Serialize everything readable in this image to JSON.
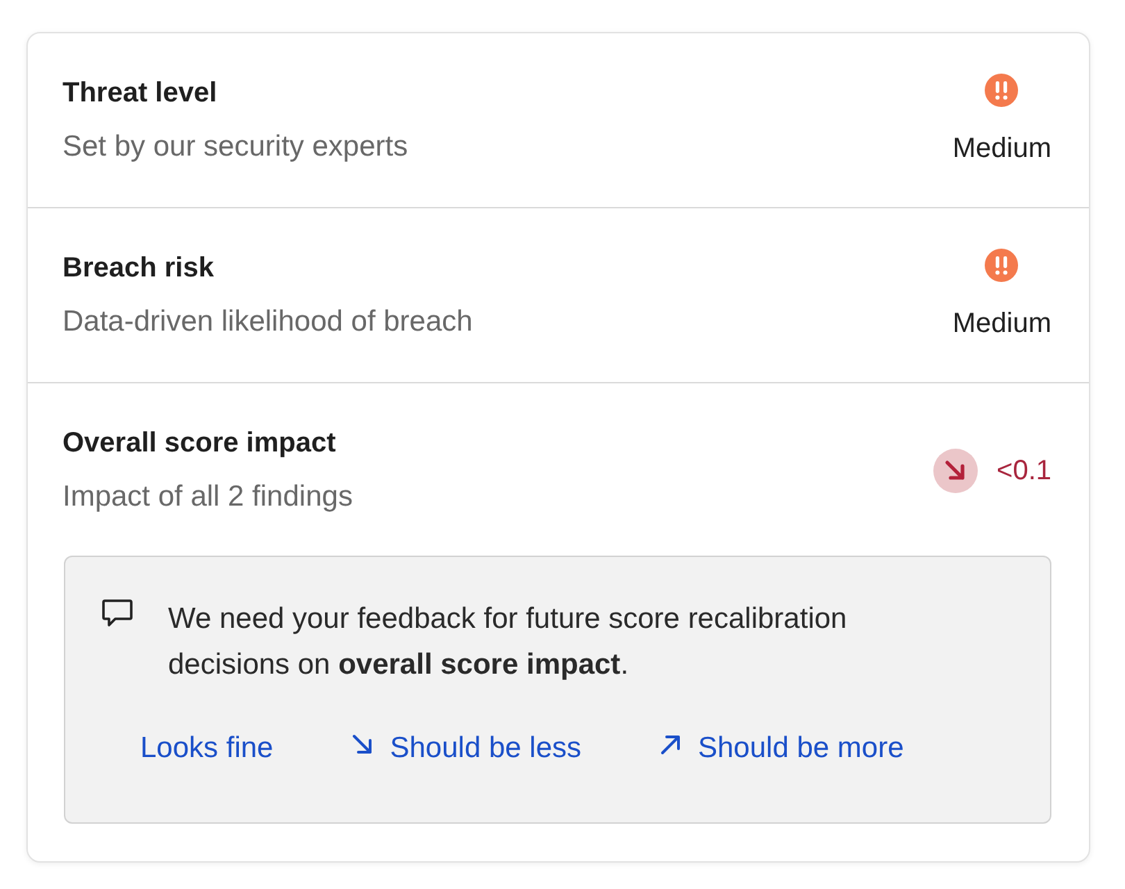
{
  "rows": [
    {
      "kind": "severity",
      "title": "Threat level",
      "subtitle": "Set by our security experts",
      "value": "Medium"
    },
    {
      "kind": "severity",
      "title": "Breach risk",
      "subtitle": "Data-driven likelihood of breach",
      "value": "Medium"
    },
    {
      "kind": "impact",
      "title": "Overall score impact",
      "subtitle": "Impact of all 2 findings",
      "value": "<0.1",
      "decreasing": true
    }
  ],
  "feedback": {
    "message": "We need your feedback for future score recalibration decisions on **overall score impact**.",
    "options": [
      {
        "kind": "plain",
        "label": "Looks fine"
      },
      {
        "kind": "less",
        "label": "Should be less"
      },
      {
        "kind": "more",
        "label": "Should be more"
      }
    ]
  }
}
